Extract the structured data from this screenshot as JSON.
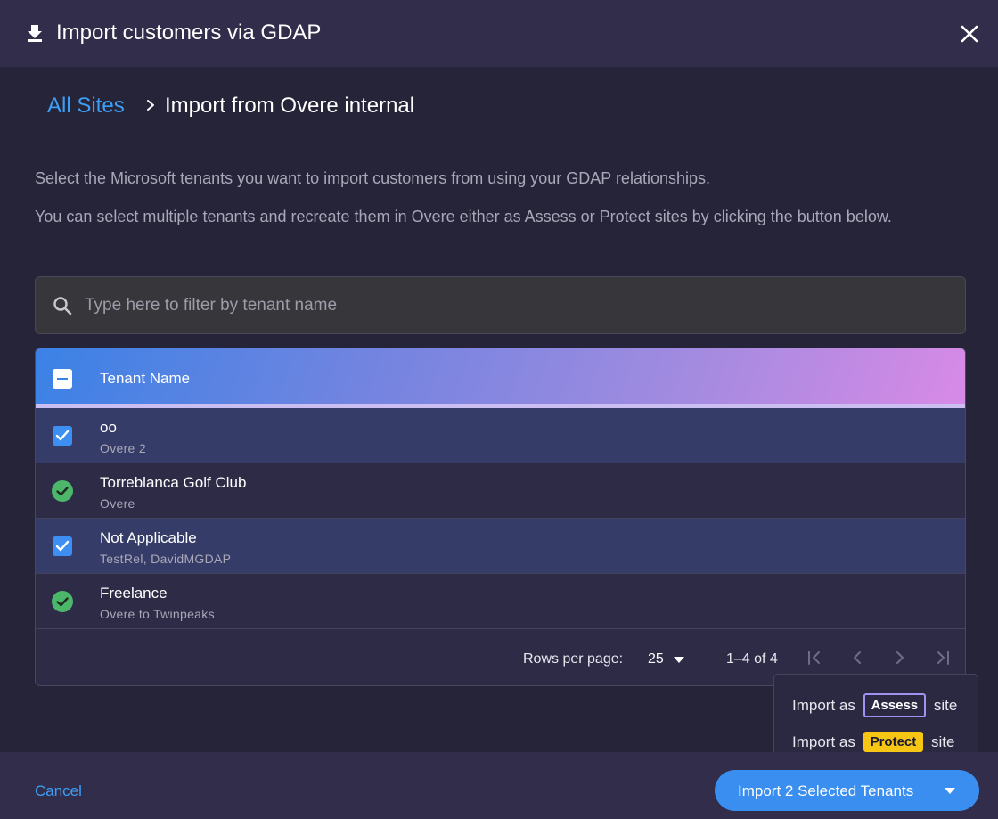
{
  "dialog": {
    "title": "Import customers via GDAP",
    "icons": {
      "title_icon": "download-icon",
      "close_icon": "close-icon"
    }
  },
  "breadcrumb": {
    "root_label": "All Sites",
    "current_label": "Import from Overe internal"
  },
  "description": {
    "line1": "Select the Microsoft tenants you want to import customers from using your GDAP relationships.",
    "line2": "You can select multiple tenants and recreate them in Overe either as Assess or Protect sites by clicking the button below."
  },
  "search": {
    "placeholder": "Type here to filter by tenant name",
    "value": ""
  },
  "table": {
    "column_header": "Tenant Name",
    "master_checkbox_state": "indeterminate",
    "rows": [
      {
        "name": "oo",
        "relationship": "Overe 2",
        "status": "selected"
      },
      {
        "name": "Torreblanca Golf Club",
        "relationship": "Overe",
        "status": "imported"
      },
      {
        "name": "Not Applicable",
        "relationship": "TestRel, DavidMGDAP",
        "status": "selected"
      },
      {
        "name": "Freelance",
        "relationship": "Overe to Twinpeaks",
        "status": "imported"
      }
    ]
  },
  "pagination": {
    "rows_per_page_label": "Rows per page:",
    "rows_per_page_value": "25",
    "range_label": "1–4 of 4"
  },
  "import_menu": {
    "assess": {
      "prefix": "Import as",
      "badge": "Assess",
      "suffix": "site"
    },
    "protect": {
      "prefix": "Import as",
      "badge": "Protect",
      "suffix": "site"
    }
  },
  "footer": {
    "cancel_label": "Cancel",
    "import_label": "Import 2 Selected Tenants"
  },
  "colors": {
    "accent_blue": "#3a8ef0",
    "link_blue": "#3d9ef5",
    "success_green": "#4cb76a",
    "protect_yellow": "#f7c614",
    "background": "#262438"
  }
}
